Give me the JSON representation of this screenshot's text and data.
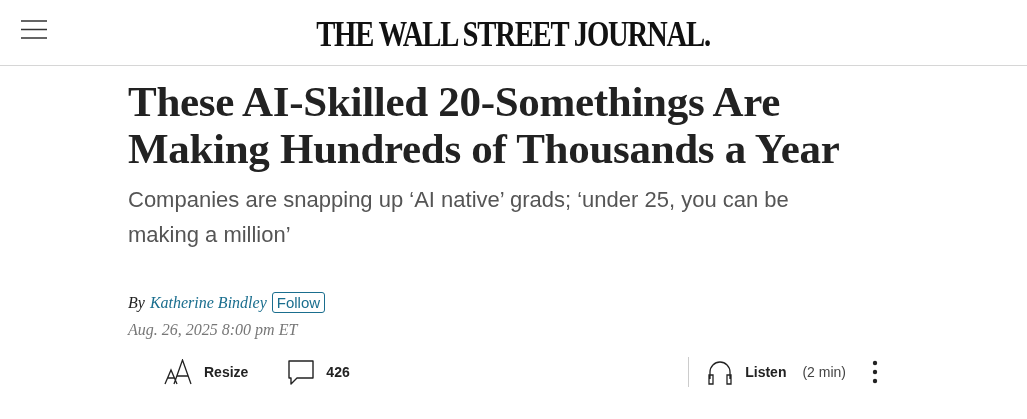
{
  "masthead": {
    "title": "THE WALL STREET JOURNAL."
  },
  "headline": "These AI-Skilled 20-Somethings Are Making Hundreds of Thousands a Year",
  "subtitle": "Companies are snapping up ‘AI native’ grads; ‘under 25, you can be making a million’",
  "byline": {
    "prefix": "By",
    "author": "Katherine Bindley",
    "follow": "Follow"
  },
  "date": "Aug. 26, 2025 8:00 pm ET",
  "tools": [
    {
      "kind": "resize",
      "label": "Resize"
    },
    {
      "kind": "comments",
      "label": "426"
    },
    {
      "kind": "listen",
      "label": "Listen",
      "note": "(2 min)"
    }
  ]
}
